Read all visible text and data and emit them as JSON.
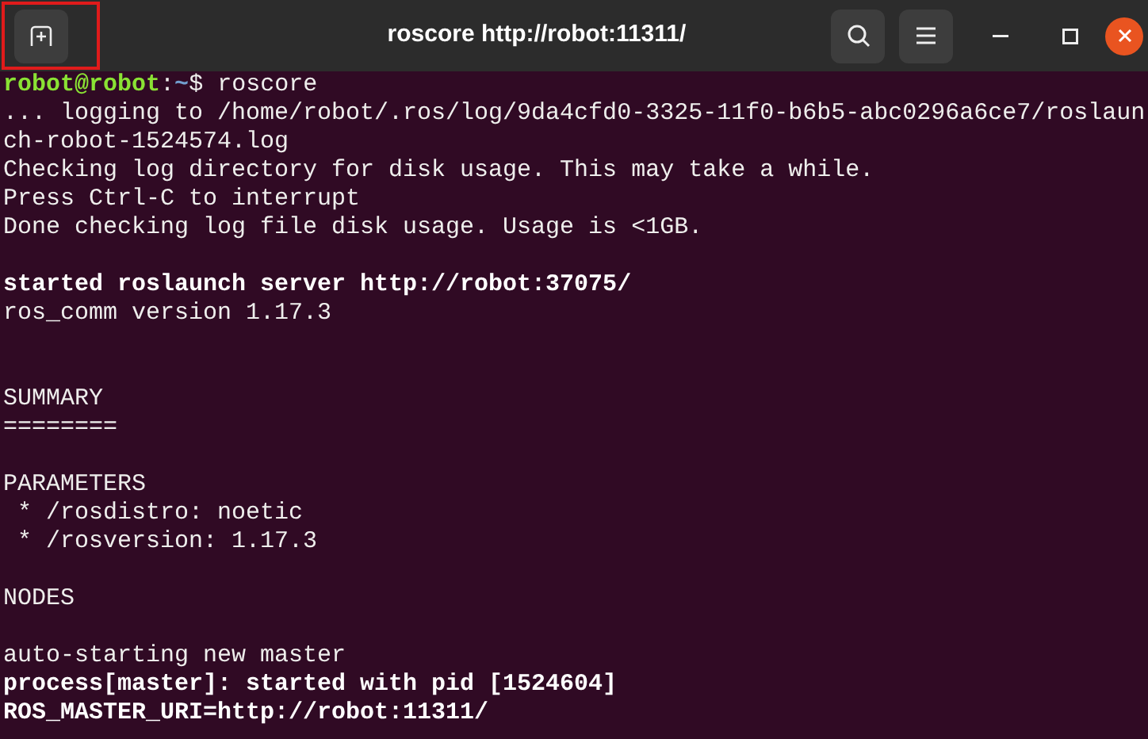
{
  "window": {
    "title": "roscore http://robot:11311/"
  },
  "highlight": {
    "on": true
  },
  "prompt": {
    "user_host": "robot@robot",
    "separator": ":",
    "path": "~",
    "symbol": "$",
    "command": " roscore"
  },
  "lines": [
    {
      "kind": "text",
      "text": "... logging to /home/robot/.ros/log/9da4cfd0-3325-11f0-b6b5-abc0296a6ce7/roslaun"
    },
    {
      "kind": "text",
      "text": "ch-robot-1524574.log"
    },
    {
      "kind": "text",
      "text": "Checking log directory for disk usage. This may take a while."
    },
    {
      "kind": "text",
      "text": "Press Ctrl-C to interrupt"
    },
    {
      "kind": "text",
      "text": "Done checking log file disk usage. Usage is <1GB."
    },
    {
      "kind": "blank"
    },
    {
      "kind": "bold",
      "text": "started roslaunch server http://robot:37075/"
    },
    {
      "kind": "text",
      "text": "ros_comm version 1.17.3"
    },
    {
      "kind": "blank"
    },
    {
      "kind": "blank"
    },
    {
      "kind": "text",
      "text": "SUMMARY"
    },
    {
      "kind": "text",
      "text": "========"
    },
    {
      "kind": "blank"
    },
    {
      "kind": "text",
      "text": "PARAMETERS"
    },
    {
      "kind": "text",
      "text": " * /rosdistro: noetic"
    },
    {
      "kind": "text",
      "text": " * /rosversion: 1.17.3"
    },
    {
      "kind": "blank"
    },
    {
      "kind": "text",
      "text": "NODES"
    },
    {
      "kind": "blank"
    },
    {
      "kind": "text",
      "text": "auto-starting new master"
    },
    {
      "kind": "bold",
      "text": "process[master]: started with pid [1524604]"
    },
    {
      "kind": "bold",
      "text": "ROS_MASTER_URI=http://robot:11311/"
    }
  ]
}
